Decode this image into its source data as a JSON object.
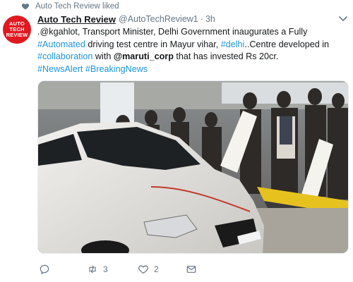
{
  "social_context": {
    "text": "Auto Tech Review liked",
    "icon": "heart-icon"
  },
  "avatar": {
    "line1": "AUTO",
    "line2": "TECH",
    "line3": "REVIEW",
    "color": "#e0191f"
  },
  "tweet": {
    "display_name": "Auto Tech Review",
    "handle": "@AutoTechReview1",
    "separator": "·",
    "time": "3h",
    "text": {
      "p1": ".@kgahlot, Transport Minister, Delhi Government inaugurates a Fully ",
      "tag_automated": "#Automated",
      "p2": " driving test centre in Mayur vihar, ",
      "tag_delhi": "#delhi",
      "p3": "..Centre developed in ",
      "tag_collab": "#collaboration",
      "p4": " with ",
      "mention": "@maruti_corp",
      "p5": " that has invested Rs 20cr.",
      "tag_news": "#NewsAlert",
      "tag_breaking": "#BreakingNews"
    },
    "media": {
      "kind": "photo",
      "description_icon": "photo-car-inauguration"
    }
  },
  "actions": {
    "reply": {
      "icon": "reply-icon"
    },
    "retweet": {
      "icon": "retweet-icon",
      "count": "3"
    },
    "like": {
      "icon": "like-heart-icon",
      "count": "2"
    },
    "dm": {
      "icon": "envelope-icon"
    }
  },
  "colors": {
    "link": "#1b95e0",
    "muted": "#657786",
    "text": "#14171a"
  }
}
